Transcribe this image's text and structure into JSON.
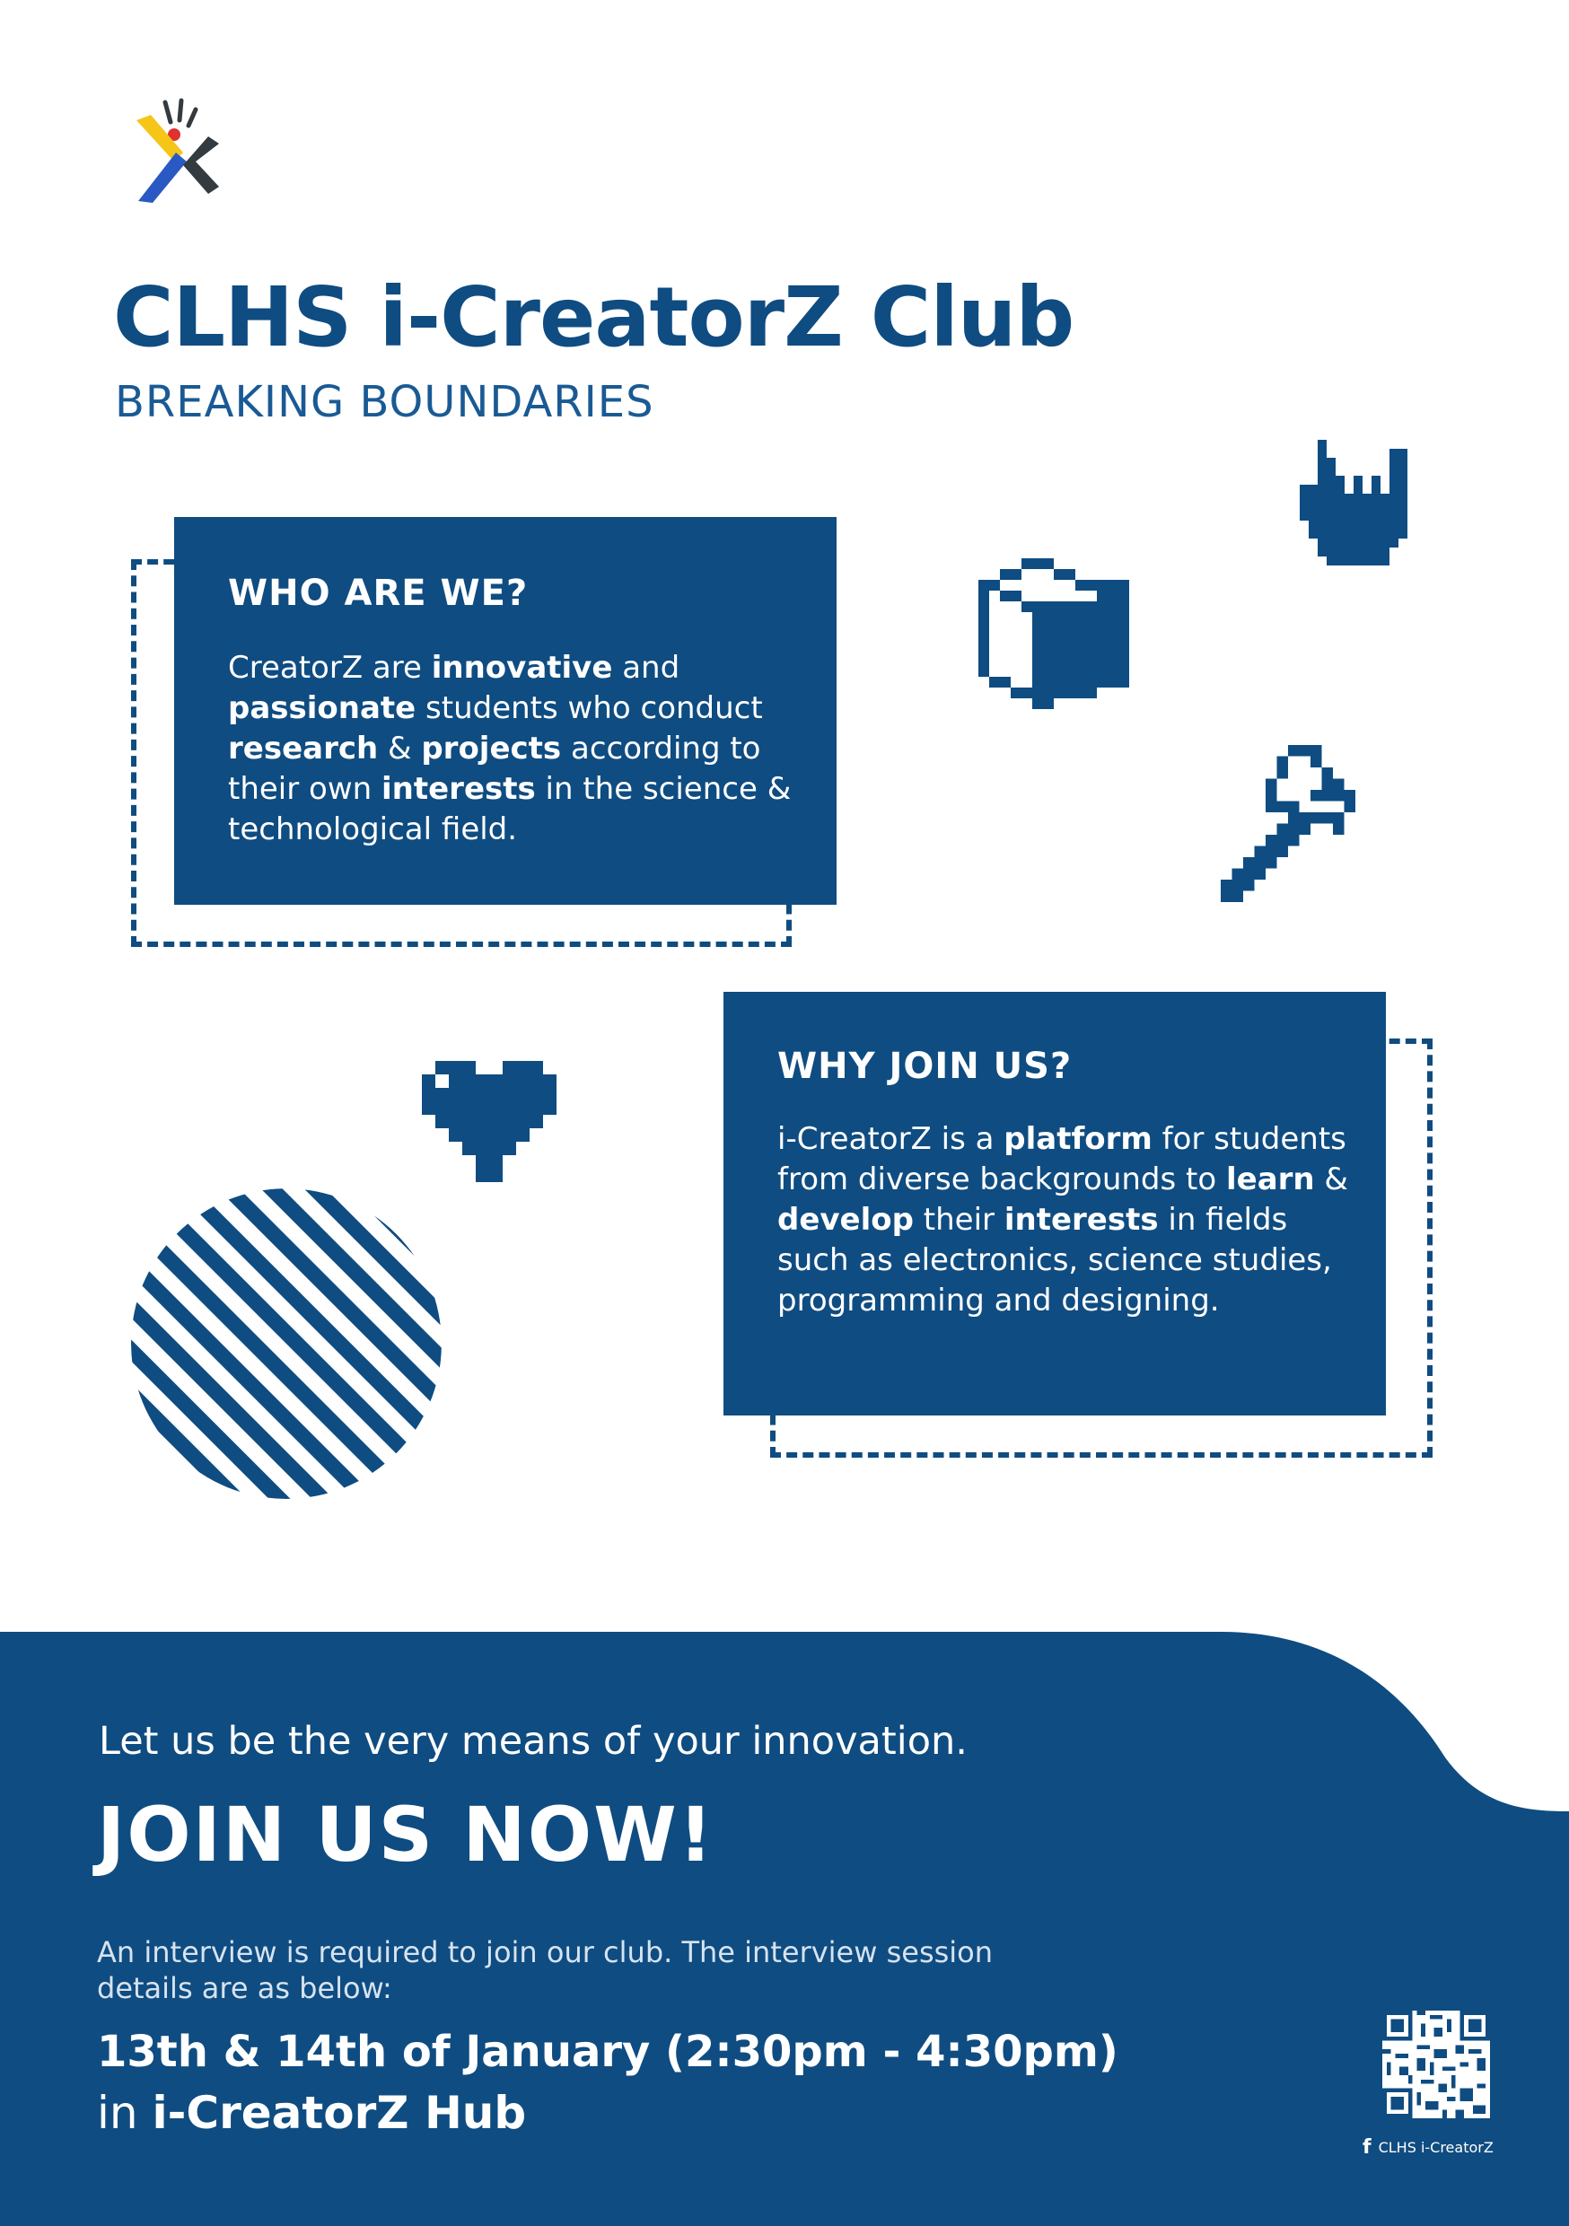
{
  "header": {
    "title": "CLHS i-CreatorZ Club",
    "subtitle": "BREAKING BOUNDARIES"
  },
  "who": {
    "heading": "WHO ARE WE?",
    "body": [
      {
        "t": "CreatorZ are ",
        "b": false
      },
      {
        "t": "innovative",
        "b": true
      },
      {
        "t": " and ",
        "b": false
      },
      {
        "t": "passionate",
        "b": true
      },
      {
        "t": " students who conduct ",
        "b": false
      },
      {
        "t": "research",
        "b": true
      },
      {
        "t": " & ",
        "b": false
      },
      {
        "t": "projects",
        "b": true
      },
      {
        "t": " according to their own ",
        "b": false
      },
      {
        "t": "interests",
        "b": true
      },
      {
        "t": " in the science & technological field.",
        "b": false
      }
    ]
  },
  "why": {
    "heading": "WHY JOIN US?",
    "body": [
      {
        "t": "i-CreatorZ is a ",
        "b": false
      },
      {
        "t": "platform",
        "b": true
      },
      {
        "t": " for students from diverse backgrounds to ",
        "b": false
      },
      {
        "t": "learn",
        "b": true
      },
      {
        "t": " & ",
        "b": false
      },
      {
        "t": "develop",
        "b": true
      },
      {
        "t": " their ",
        "b": false
      },
      {
        "t": "interests",
        "b": true
      },
      {
        "t": " in fields such as electronics, science studies, programming and designing.",
        "b": false
      }
    ]
  },
  "footer": {
    "tagline": "Let us be the very means of your innovation.",
    "cta": "JOIN US NOW!",
    "interview_note": "An interview is required to join our club. The interview session details are as below:",
    "date": "13th & 14th of January (2:30pm - 4:30pm)",
    "place_prefix": "in ",
    "place": "i-CreatorZ Hub",
    "facebook_label": "CLHS i-CreatorZ",
    "facebook_icon": "f"
  },
  "colors": {
    "primary": "#0f4c81",
    "white": "#ffffff",
    "logo_yellow": "#f5c518",
    "logo_blue": "#2b59c3",
    "logo_red": "#e03131",
    "logo_dark": "#333a40"
  },
  "icons": [
    "logo-icon",
    "rock-hand-icon",
    "cube-icon",
    "wrench-icon",
    "heart-icon",
    "striped-circle-icon",
    "qr-code-icon",
    "facebook-icon"
  ]
}
